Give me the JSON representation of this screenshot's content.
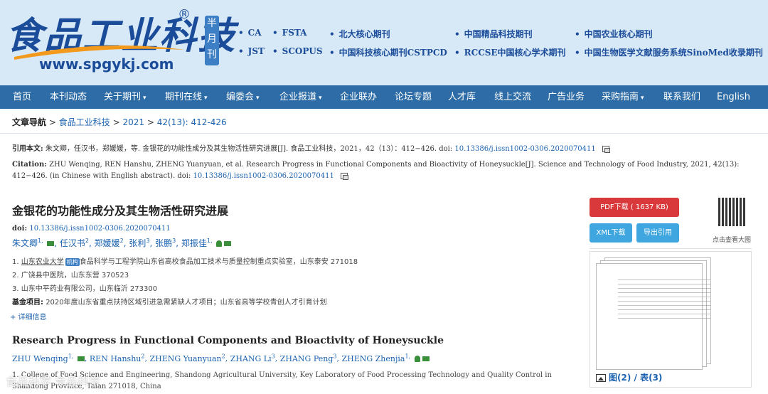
{
  "header": {
    "logo_text": "食品工业科技",
    "logo_reg": "®",
    "logo_url": "www.spgykj.com",
    "monthly": [
      "半",
      "月",
      "刊"
    ],
    "indexes_row1": [
      "CA",
      "FSTA",
      "北大核心期刊",
      "中国精品科技期刊",
      "中国农业核心期刊"
    ],
    "indexes_row2": [
      "JST",
      "SCOPUS",
      "中国科技核心期刊CSTPCD",
      "RCCSE中国核心学术期刊",
      "中国生物医学文献服务系统SinoMed收录期刊"
    ]
  },
  "nav": {
    "items": [
      {
        "label": "首页",
        "caret": ""
      },
      {
        "label": "本刊动态",
        "caret": ""
      },
      {
        "label": "关于期刊",
        "caret": "▾"
      },
      {
        "label": "期刊在线",
        "caret": "▾"
      },
      {
        "label": "编委会",
        "caret": "▾"
      },
      {
        "label": "企业报道",
        "caret": "▾"
      },
      {
        "label": "企业联办",
        "caret": ""
      },
      {
        "label": "论坛专题",
        "caret": ""
      },
      {
        "label": "人才库",
        "caret": ""
      },
      {
        "label": "线上交流",
        "caret": ""
      },
      {
        "label": "广告业务",
        "caret": ""
      },
      {
        "label": "采购指南",
        "caret": "▾"
      },
      {
        "label": "联系我们",
        "caret": ""
      },
      {
        "label": "English",
        "caret": ""
      }
    ]
  },
  "breadcrumb": {
    "label": "文章导航",
    "sep": ">",
    "journal": "食品工业科技",
    "year": "2021",
    "issue": "42(13): 412-426"
  },
  "citation_cn": {
    "label": "引用本文:",
    "text": "朱文卿，任汉书，郑媛媛，等. 金银花的功能性成分及其生物活性研究进展[J]. 食品工业科技，2021，42（13）：412−426. doi: ",
    "doi": "10.13386/j.issn1002-0306.2020070411"
  },
  "citation_en": {
    "label": "Citation:",
    "text": "ZHU Wenqing, REN Hanshu, ZHENG Yuanyuan, et al. Research Progress in Functional Components and Bioactivity of Honeysuckle[J]. Science and Technology of Food Industry, 2021, 42(13): 412−426. (in Chinese with English abstract). doi: ",
    "doi": "10.13386/j.issn1002-0306.2020070411"
  },
  "article": {
    "title_cn": "金银花的功能性成分及其生物活性研究进展",
    "doi_label": "doi:",
    "doi": "10.13386/j.issn1002-0306.2020070411",
    "authors_cn": [
      {
        "name": "朱文卿",
        "sup": "1, ",
        "mail": true
      },
      {
        "name": "任汉书",
        "sup": "2",
        "mail": false
      },
      {
        "name": "郑媛媛",
        "sup": "2",
        "mail": false
      },
      {
        "name": "张利",
        "sup": "3",
        "mail": false
      },
      {
        "name": "张鹏",
        "sup": "3",
        "mail": false
      },
      {
        "name": "郑振佳",
        "sup": "1, ",
        "mail": true
      }
    ],
    "affiliations": [
      {
        "num": "1.",
        "link": "山东农业大学",
        "badge": "机构",
        "text": "食品科学与工程学院山东省高校食品加工技术与质量控制重点实验室，山东泰安 271018"
      },
      {
        "num": "2.",
        "link": "",
        "badge": "",
        "text": "广饶县中医院，山东东营 370523"
      },
      {
        "num": "3.",
        "link": "",
        "badge": "",
        "text": "山东中平药业有限公司，山东临沂 273300"
      }
    ],
    "fund_label": "基金项目:",
    "fund_text": "2020年度山东省重点扶持区域引进急需紧缺人才项目；山东省高等学校青创人才引育计划",
    "more_label": "+ 详细信息",
    "title_en": "Research Progress in Functional Components and Bioactivity of Honeysuckle",
    "authors_en": [
      {
        "name": "ZHU Wenqing",
        "sup": "1, "
      },
      {
        "name": "REN Hanshu",
        "sup": "2"
      },
      {
        "name": "ZHENG Yuanyuan",
        "sup": "2"
      },
      {
        "name": "ZHANG Li",
        "sup": "3"
      },
      {
        "name": "ZHANG Peng",
        "sup": "3"
      },
      {
        "name": "ZHENG Zhenjia",
        "sup": "1, "
      }
    ],
    "aff_en": "1. College of Food Science and Engineering, Shandong Agricultural University, Key Laboratory of Food Processing Technology and Quality Control in Shandong Province, Taian 271018, China"
  },
  "sidebar": {
    "pdf_label": "PDF下载 ( 1637 KB)",
    "xml_label": "XML下载",
    "export_label": "导出引用",
    "qr_label": "点击查看大图",
    "fig_link": "图(2)",
    "fig_sep": " / ",
    "table_link": "表(3)"
  },
  "watermark": "食品科学 食品科学"
}
